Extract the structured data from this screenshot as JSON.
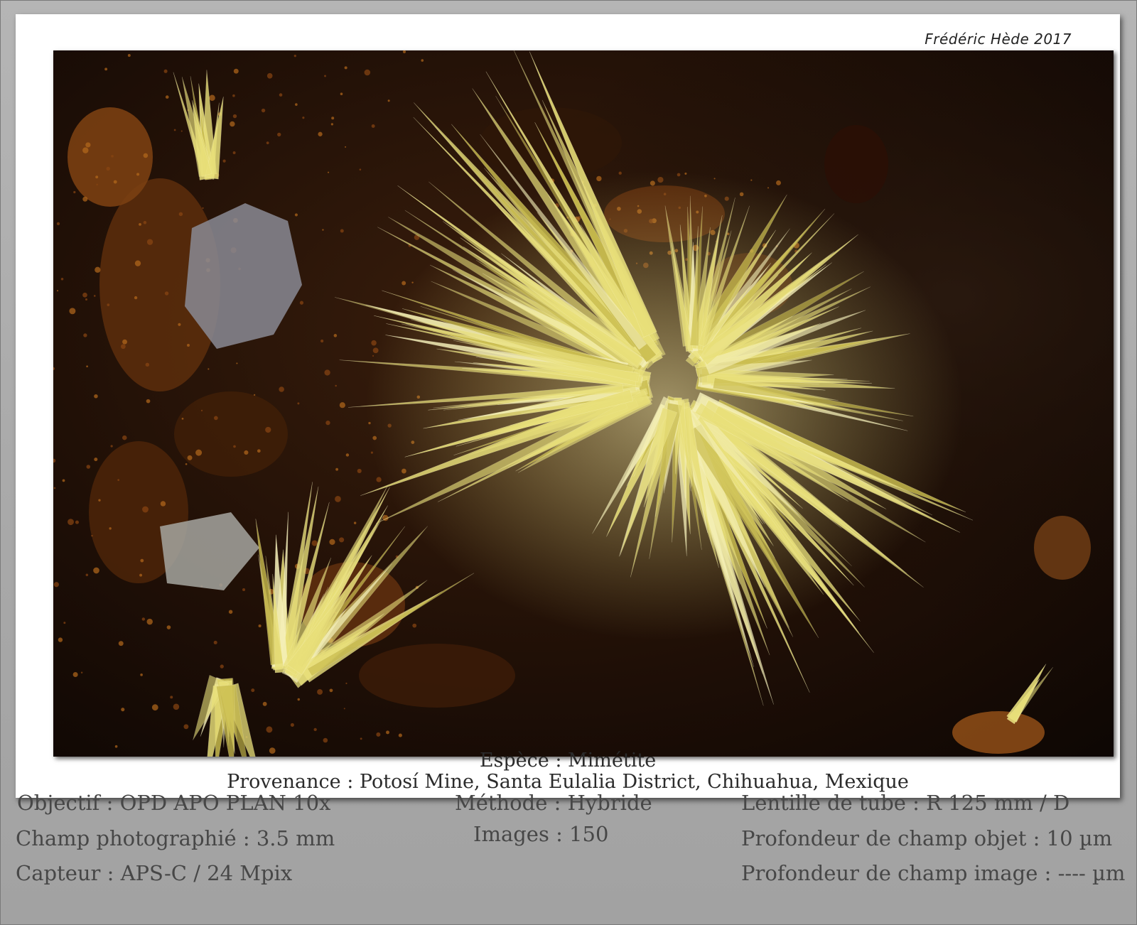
{
  "signature": "Frédéric Hède 2017",
  "photo": {
    "subject": "mimetite-crystal-spray-photo"
  },
  "caption": {
    "species": "Espèce : Mimétite",
    "origin": "Provenance : Potosí Mine, Santa Eulalia District,  Chihuahua, Mexique"
  },
  "specs": {
    "objective": "Objectif : OPD APO PLAN 10x",
    "field": "Champ photographié : 3.5 mm",
    "sensor": "Capteur : APS-C / 24 Mpix",
    "method": "Méthode : Hybride",
    "images": "Images : 150",
    "tube_lens": "Lentille de tube : R 125 mm / D",
    "object_depth": "Profondeur de champ objet : 10 µm",
    "image_depth": "Profondeur de champ image : ---- µm"
  },
  "colors": {
    "background": "#a9a9a9",
    "mat": "#ffffff",
    "crystal": "#e8df7a",
    "matrix": "#6e3a12"
  }
}
